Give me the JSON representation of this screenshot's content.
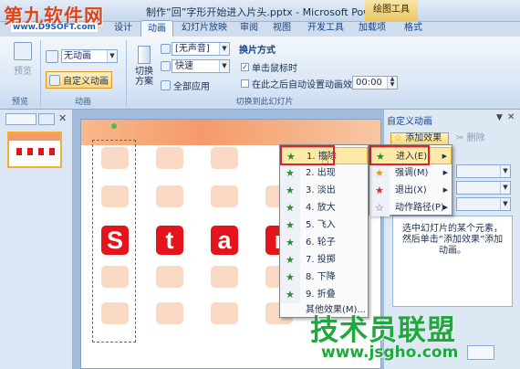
{
  "title": {
    "logo": "第九软件网",
    "logo_url": "www.D9SOFT.com",
    "document": "制作“回”字形开始进入片头.pptx - Microsoft PowerPoint",
    "context_tab": "绘图工具"
  },
  "tabs": [
    "设计",
    "动画",
    "幻灯片放映",
    "审阅",
    "视图",
    "开发工具",
    "加载项",
    "格式"
  ],
  "active_tab": "动画",
  "ribbon": {
    "preview": {
      "button": "预览",
      "group": "预览"
    },
    "animations": {
      "combo_value": "无动画",
      "custom_button": "自定义动画",
      "group": "动画"
    },
    "transition": {
      "scheme_label": "切换\n方案",
      "sound_value": "[无声音]",
      "speed_value": "快速",
      "apply_all": "全部应用",
      "advance_header": "换片方式",
      "on_click": "单击鼠标时",
      "on_click_checked": true,
      "after_label": "在此之后自动设置动画效果:",
      "after_checked": false,
      "after_value": "00:00",
      "group": "切换到此幻灯片"
    }
  },
  "slide": {
    "letters": [
      "S",
      "t",
      "a",
      "r"
    ]
  },
  "task_pane": {
    "title": "自定义动画",
    "add_effect": "添加效果",
    "remove": "删除",
    "description": "选中幻灯片的某个元素，然后单击“添加效果”添加动画。"
  },
  "effect_menu": {
    "items": [
      "进入(E)",
      "强调(M)",
      "退出(X)",
      "动作路径(P)"
    ],
    "highlighted": "进入(E)"
  },
  "entrance_menu": {
    "items": [
      "1. 擦除",
      "2. 出现",
      "3. 淡出",
      "4. 放大",
      "5. 飞入",
      "6. 轮子",
      "7. 投掷",
      "8. 下降",
      "9. 折叠"
    ],
    "more": "其他效果(M)...",
    "highlighted": "1. 擦除"
  },
  "watermark": {
    "text": "技术员联盟",
    "url": "www.jsgho.com"
  },
  "colors": {
    "accent": "#e3141b",
    "highlight": "#ffe9a8",
    "watermark": "#1fa83d"
  }
}
